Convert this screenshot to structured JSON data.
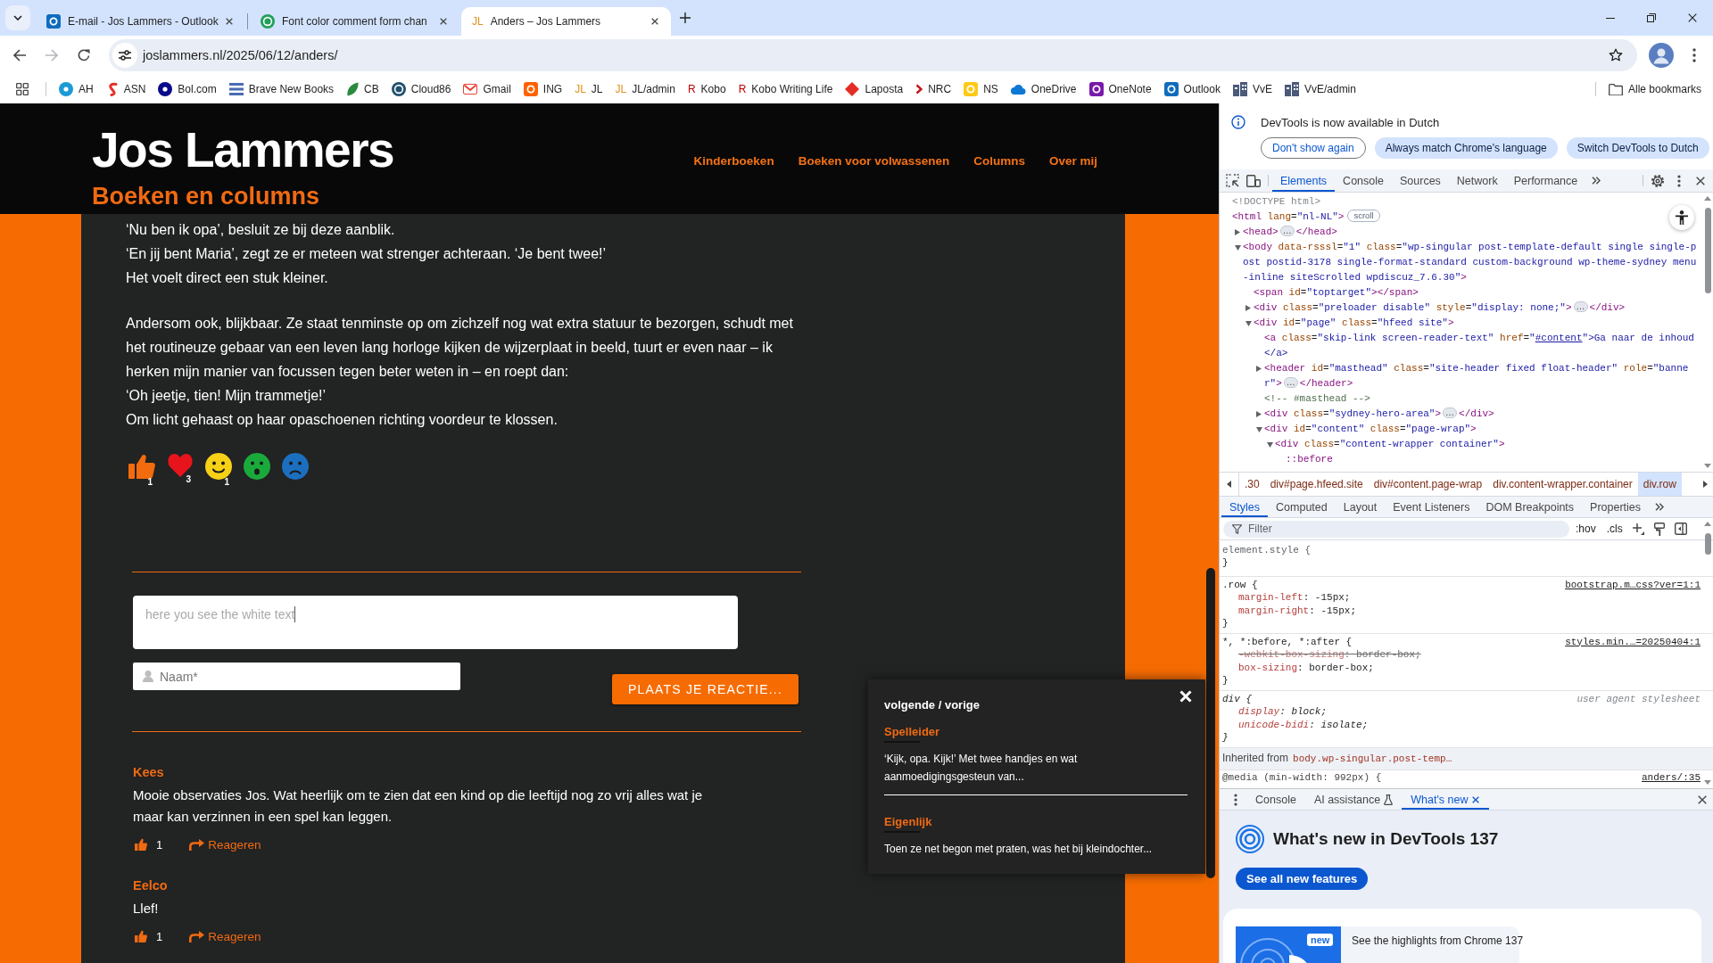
{
  "browser": {
    "tabs": [
      {
        "title": "E-mail - Jos Lammers - Outlook",
        "kind": "tile",
        "color": "#0f6cbd",
        "selected": false
      },
      {
        "title": "Font color comment form chan",
        "kind": "ring",
        "color": "#21a05a",
        "selected": false
      },
      {
        "title": "Anders – Jos Lammers",
        "kind": "monogram",
        "favicon": "JL",
        "color": "#e0901e",
        "selected": true
      }
    ],
    "toolbar": {
      "buttons": [
        {
          "kind": "back",
          "disabled": false
        },
        {
          "kind": "forward",
          "disabled": true
        },
        {
          "kind": "reload",
          "disabled": false
        }
      ],
      "address": "joslammers.nl/2025/06/12/anders/"
    },
    "bookmarks": [
      {
        "label": "AH",
        "kind": "circle",
        "color": "#1c9ad6"
      },
      {
        "label": "ASN",
        "kind": "squiggle",
        "color": "#e4322b"
      },
      {
        "label": "Bol.com",
        "kind": "circle",
        "color": "#0a0a8c"
      },
      {
        "label": "Brave New Books",
        "kind": "stripes",
        "color": "#4a6bb3"
      },
      {
        "label": "CB",
        "kind": "leaf",
        "color": "#2c8a3e"
      },
      {
        "label": "Cloud86",
        "kind": "ring",
        "color": "#22506e"
      },
      {
        "label": "Gmail",
        "kind": "envelope",
        "color": "#ea4335"
      },
      {
        "label": "ING",
        "kind": "tile",
        "color": "#ff6200"
      },
      {
        "label": "JL",
        "kind": "monogram",
        "favicon": "JL",
        "color": "#e0901e"
      },
      {
        "label": "JL/admin",
        "kind": "monogram",
        "favicon": "JL",
        "color": "#e0901e"
      },
      {
        "label": "Kobo",
        "kind": "monogram",
        "favicon": "R",
        "color": "#bf0000"
      },
      {
        "label": "Kobo Writing Life",
        "kind": "monogram",
        "favicon": "R",
        "color": "#bf0000"
      },
      {
        "label": "Laposta",
        "kind": "diamond",
        "color": "#e52d27"
      },
      {
        "label": "NRC",
        "kind": "chevron",
        "color": "#c4161c"
      },
      {
        "label": "NS",
        "kind": "tile",
        "color": "#ffc917"
      },
      {
        "label": "OneDrive",
        "kind": "cloud",
        "color": "#0f78d4"
      },
      {
        "label": "OneNote",
        "kind": "tile",
        "color": "#7719aa"
      },
      {
        "label": "Outlook",
        "kind": "tile",
        "color": "#0f6cbd"
      },
      {
        "label": "VvE",
        "kind": "building",
        "color": "#4b5a78"
      },
      {
        "label": "VvE/admin",
        "kind": "building",
        "color": "#4b5a78"
      }
    ],
    "all_bookmarks": "Alle bookmarks"
  },
  "page": {
    "site_title": "Jos Lammers",
    "tagline": "Boeken en columns",
    "menu": [
      "Kinderboeken",
      "Boeken voor volwassenen",
      "Columns",
      "Over mij"
    ],
    "paragraphs": [
      [
        "‘Nu ben ik opa’, besluit ze bij deze aanblik.",
        "‘En jij bent Maria’, zegt ze er meteen wat strenger achteraan. ‘Je bent twee!’",
        "Het voelt direct een stuk kleiner."
      ],
      [
        "Andersom ook, blijkbaar. Ze staat tenminste op om zichzelf nog wat extra statuur te bezorgen, schudt met het routineuze gebaar van een leven lang horloge kijken de wijzerplaat in beeld, tuurt er even naar – ik herken mijn manier van focussen tegen beter weten in – en roept dan:",
        "‘Oh jeetje, tien! Mijn trammetje!’",
        "Om licht gehaast op haar opaschoenen richting voordeur te klossen."
      ]
    ],
    "reactions": [
      {
        "kind": "thumb",
        "color": "#f26c0d",
        "count": "1"
      },
      {
        "kind": "heart",
        "color": "#e8141c",
        "count": "3"
      },
      {
        "kind": "smile",
        "color": "#f7d117",
        "count": "1"
      },
      {
        "kind": "surprised",
        "color": "#1aaa3c"
      },
      {
        "kind": "sad",
        "color": "#1c6fbf"
      }
    ],
    "comment_form": {
      "comment_field": {
        "value": "here you see the white text"
      },
      "name_field": {
        "placeholder": "Naam*"
      },
      "submit": "PLAATS JE REACTIE..."
    },
    "comments": [
      {
        "author": "Kees",
        "text": "Mooie observaties Jos. Wat heerlijk om te zien dat een kind op die leeftijd nog zo vrij alles wat je maar kan verzinnen in een spel kan leggen.",
        "likes": "1",
        "reply": "Reageren"
      },
      {
        "author": "Eelco",
        "text": "Llef!",
        "likes": "1",
        "reply": "Reageren"
      }
    ],
    "related": {
      "title": "volgende / vorige",
      "posts": [
        {
          "title": "Spelleider",
          "excerpt": "‘Kijk, opa. Kijk!’ Met twee handjes en wat aanmoedigingsgesteun van..."
        },
        {
          "title": "Eigenlijk",
          "excerpt": "Toen ze net begon met praten, was het bij kleindochter..."
        }
      ]
    }
  },
  "devtools": {
    "infobar": {
      "message": "DevTools is now available in Dutch",
      "buttons": [
        {
          "label": "Don't show again",
          "kind": "outline"
        },
        {
          "label": "Always match Chrome's language",
          "kind": "tonal"
        },
        {
          "label": "Switch DevTools to Dutch",
          "kind": "tonal"
        }
      ]
    },
    "panels": [
      {
        "label": "Elements",
        "selected": true
      },
      {
        "label": "Console",
        "selected": false
      },
      {
        "label": "Sources",
        "selected": false
      },
      {
        "label": "Network",
        "selected": false
      },
      {
        "label": "Performance",
        "selected": false
      }
    ],
    "dom_tree": [
      {
        "kind": "doctype",
        "text": "<!DOCTYPE html>"
      },
      {
        "kind": "element",
        "text": "<html lang=\"nl-NL\">",
        "badge": {
          "kind": "scroll",
          "text": "scroll"
        },
        "children": [
          {
            "kind": "element",
            "text": "<head>",
            "expanded": false,
            "badge": {
              "kind": "ellipsis",
              "text": "…"
            },
            "closing": "</head>"
          },
          {
            "kind": "element",
            "text": "<body data-rsssl=\"1\" class=\"wp-singular post-template-default single single-post postid-3178 single-format-standard custom-background wp-theme-sydney menu-inline siteScrolled wpdiscuz_7.6.30\">",
            "expanded": true,
            "children": [
              {
                "kind": "element",
                "text": "<span id=\"toptarget\"></span>"
              },
              {
                "kind": "element",
                "text": "<div class=\"preloader disable\" style=\"display: none;\">",
                "expanded": false,
                "badge": {
                  "kind": "ellipsis",
                  "text": "…"
                },
                "closing": "</div>"
              },
              {
                "kind": "element",
                "text": "<div id=\"page\" class=\"hfeed site\">",
                "expanded": true,
                "children": [
                  {
                    "kind": "element",
                    "text": "<a class=\"skip-link screen-reader-text\" href=\"",
                    "link": "#content",
                    "after": "\">Ga naar de inhoud</a>"
                  },
                  {
                    "kind": "element",
                    "text": "<header id=\"masthead\" class=\"site-header fixed float-header\" role=\"banner\">",
                    "expanded": false,
                    "badge": {
                      "kind": "ellipsis",
                      "text": "…"
                    },
                    "closing": "</header>"
                  },
                  {
                    "kind": "comment",
                    "text": "<!-- #masthead -->"
                  },
                  {
                    "kind": "element",
                    "text": "<div class=\"sydney-hero-area\">",
                    "expanded": false,
                    "badge": {
                      "kind": "ellipsis",
                      "text": "…"
                    },
                    "closing": "</div>"
                  },
                  {
                    "kind": "element",
                    "text": "<div id=\"content\" class=\"page-wrap\">",
                    "expanded": true,
                    "children": [
                      {
                        "kind": "element",
                        "text": "<div class=\"content-wrapper container\">",
                        "expanded": true,
                        "children": [
                          {
                            "kind": "pseudo",
                            "text": "::before"
                          }
                        ]
                      }
                    ]
                  }
                ]
              }
            ]
          }
        ]
      }
    ],
    "breadcrumbs": [
      {
        "label": ".30",
        "selected": false
      },
      {
        "label": "div#page.hfeed.site",
        "selected": false
      },
      {
        "label": "div#content.page-wrap",
        "selected": false
      },
      {
        "label": "div.content-wrapper.container",
        "selected": false
      },
      {
        "label": "div.row",
        "selected": true
      }
    ],
    "sidebar_tabs": [
      {
        "label": "Styles",
        "selected": true
      },
      {
        "label": "Computed",
        "selected": false
      },
      {
        "label": "Layout",
        "selected": false
      },
      {
        "label": "Event Listeners",
        "selected": false
      },
      {
        "label": "DOM Breakpoints",
        "selected": false
      },
      {
        "label": "Properties",
        "selected": false
      }
    ],
    "filter": {
      "placeholder": "Filter"
    },
    "toggles": [
      ":hov",
      ".cls"
    ],
    "rules": [
      {
        "selector": "element.style {",
        "kind": "inline",
        "close": "}"
      },
      {
        "selector": ".row {",
        "kind": "author",
        "source": "bootstrap.m…css?ver=1:1",
        "declarations": [
          {
            "text": "margin-left: -15px;",
            "overridden": false
          },
          {
            "text": "margin-right: -15px;",
            "overridden": false
          }
        ],
        "close": "}"
      },
      {
        "selector": "*, *:before, *:after {",
        "kind": "author",
        "source": "styles.min.…=20250404:1",
        "declarations": [
          {
            "text": "-webkit-box-sizing: border-box;",
            "overridden": true
          },
          {
            "text": "box-sizing: border-box;",
            "overridden": false
          }
        ],
        "close": "}"
      },
      {
        "selector": "div {",
        "kind": "user-agent",
        "source": "user agent stylesheet",
        "declarations": [
          {
            "text": "display: block;",
            "overridden": false
          },
          {
            "text": "unicode-bidi: isolate;",
            "overridden": false
          }
        ],
        "close": "}"
      }
    ],
    "inherited": {
      "label": "Inherited from",
      "selector": "body.wp-singular.post-temp…"
    },
    "media": {
      "text": "@media (min-width: 992px) {",
      "source": "anders/:35"
    },
    "drawer": {
      "tabs": [
        {
          "label": "Console",
          "selected": false,
          "experimental": false,
          "closable": false
        },
        {
          "label": "AI assistance",
          "selected": false,
          "experimental": true,
          "closable": false
        },
        {
          "label": "What's new",
          "selected": true,
          "experimental": false,
          "closable": true
        }
      ],
      "heading": "What's new in DevTools 137",
      "button": "See all new features",
      "highlight": {
        "badge": "new",
        "text": "See the highlights from Chrome 137"
      }
    }
  }
}
